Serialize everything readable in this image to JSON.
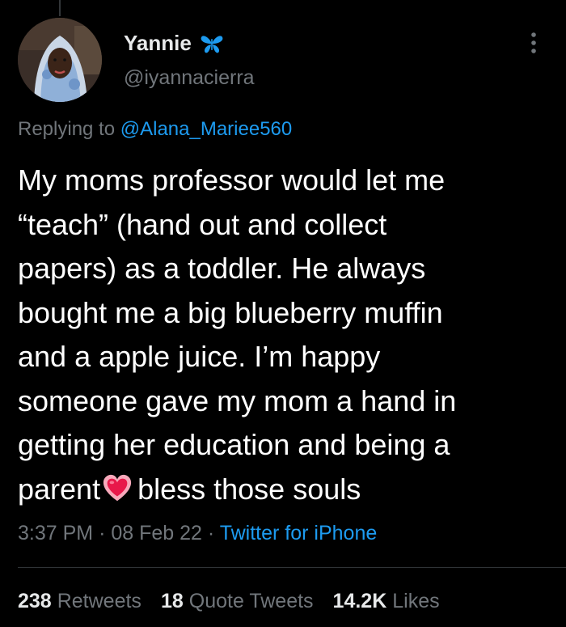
{
  "user": {
    "display_name": "Yannie",
    "handle": "@iyannacierra",
    "badge_icon": "butterfly-icon",
    "badge_color": "#1d9bf0"
  },
  "reply": {
    "prefix": "Replying to",
    "mention": "@Alana_Mariee560"
  },
  "tweet": {
    "lines": [
      "My moms professor would let me",
      "“teach” (hand out and collect",
      "papers) as a toddler. He always",
      "bought me a big blueberry muffin",
      "and a apple juice. I’m happy",
      "someone gave my mom a hand in",
      "getting her education and being a"
    ],
    "last_line_before_emoji": "parent",
    "emoji": "heart-emoji",
    "last_line_after_emoji": "bless those souls"
  },
  "meta": {
    "time": "3:37 PM",
    "separator": "·",
    "date": "08 Feb 22",
    "source": "Twitter for iPhone"
  },
  "stats": {
    "retweets_count": "238",
    "retweets_label": "Retweets",
    "quotes_count": "18",
    "quotes_label": "Quote Tweets",
    "likes_count": "14.2K",
    "likes_label": "Likes"
  },
  "colors": {
    "background": "#000000",
    "accent": "#1d9bf0",
    "secondary_text": "#71767b",
    "primary_text": "#e7e9ea"
  }
}
